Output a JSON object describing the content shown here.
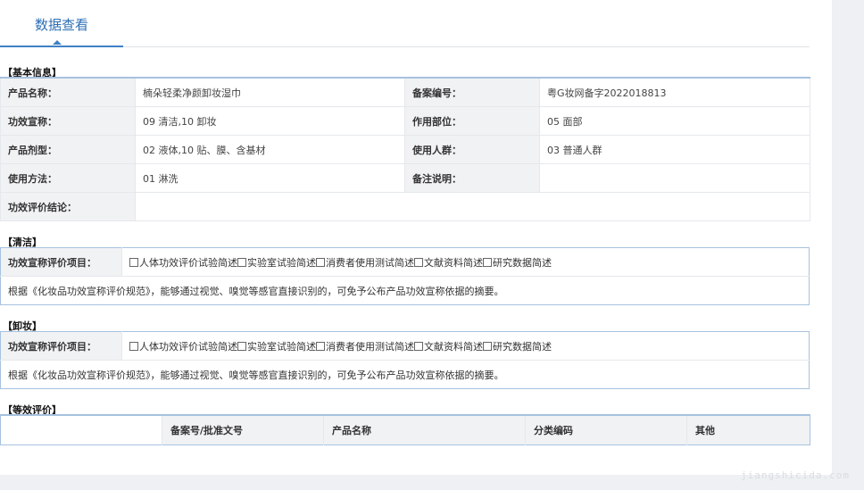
{
  "page": {
    "title": "数据查看"
  },
  "basic_info": {
    "section_label": "【基本信息】",
    "rows": [
      [
        {
          "label": "产品名称：",
          "value": "楠朵轻柔净颜卸妆湿巾"
        },
        {
          "label": "备案编号：",
          "value": "粤G妆网备字2022018813"
        }
      ],
      [
        {
          "label": "功效宣称：",
          "value": "09 清洁,10 卸妆"
        },
        {
          "label": "作用部位：",
          "value": "05 面部"
        }
      ],
      [
        {
          "label": "产品剂型：",
          "value": "02 液体,10 贴、膜、含基材"
        },
        {
          "label": "使用人群：",
          "value": "03 普通人群"
        }
      ],
      [
        {
          "label": "使用方法：",
          "value": "01 淋洗"
        },
        {
          "label": "备注说明：",
          "value": ""
        }
      ]
    ],
    "conclusion": {
      "label": "功效评价结论：",
      "value": ""
    }
  },
  "claims": [
    {
      "section_label": "【清洁】",
      "item_label": "功效宣称评价项目：",
      "options": [
        "人体功效评价试验简述",
        "实验室试验简述",
        "消费者使用测试简述",
        "文献资料简述",
        "研究数据简述"
      ],
      "note": "根据《化妆品功效宣称评价规范》，能够通过视觉、嗅觉等感官直接识别的，可免予公布产品功效宣称依据的摘要。"
    },
    {
      "section_label": "【卸妆】",
      "item_label": "功效宣称评价项目：",
      "options": [
        "人体功效评价试验简述",
        "实验室试验简述",
        "消费者使用测试简述",
        "文献资料简述",
        "研究数据简述"
      ],
      "note": "根据《化妆品功效宣称评价规范》，能够通过视觉、嗅觉等感官直接识别的，可免予公布产品功效宣称依据的摘要。"
    }
  ],
  "equivalence": {
    "section_label": "【等效评价】",
    "headers": [
      "",
      "备案号/批准文号",
      "产品名称",
      "分类编码",
      "其他"
    ]
  },
  "watermark": "jiangshicida.com"
}
